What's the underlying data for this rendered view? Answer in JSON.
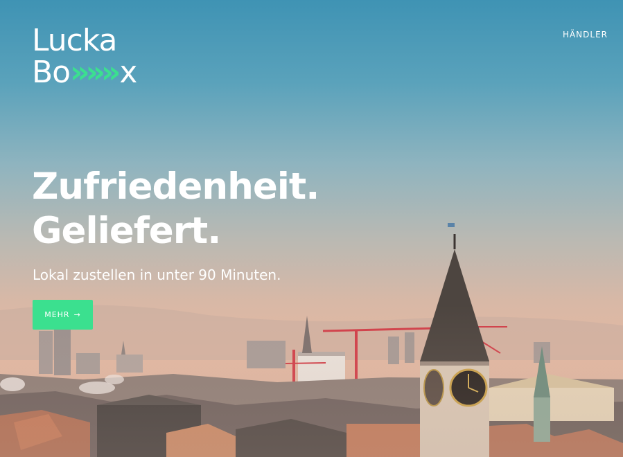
{
  "brand": {
    "line1": "Lucka",
    "line2_prefix": "Bo",
    "line2_arrows": "»»»",
    "line2_suffix": "x",
    "accent_color": "#3be08f"
  },
  "nav": {
    "haendler_label": "HÄNDLER"
  },
  "hero": {
    "headline_line1": "Zufriedenheit.",
    "headline_line2": "Geliefert.",
    "subline": "Lokal zustellen in unter 90 Minuten.",
    "cta_label": "MEHR",
    "cta_icon": "arrow-right-icon",
    "cta_arrow": "→",
    "background": "city-skyline-photo"
  }
}
